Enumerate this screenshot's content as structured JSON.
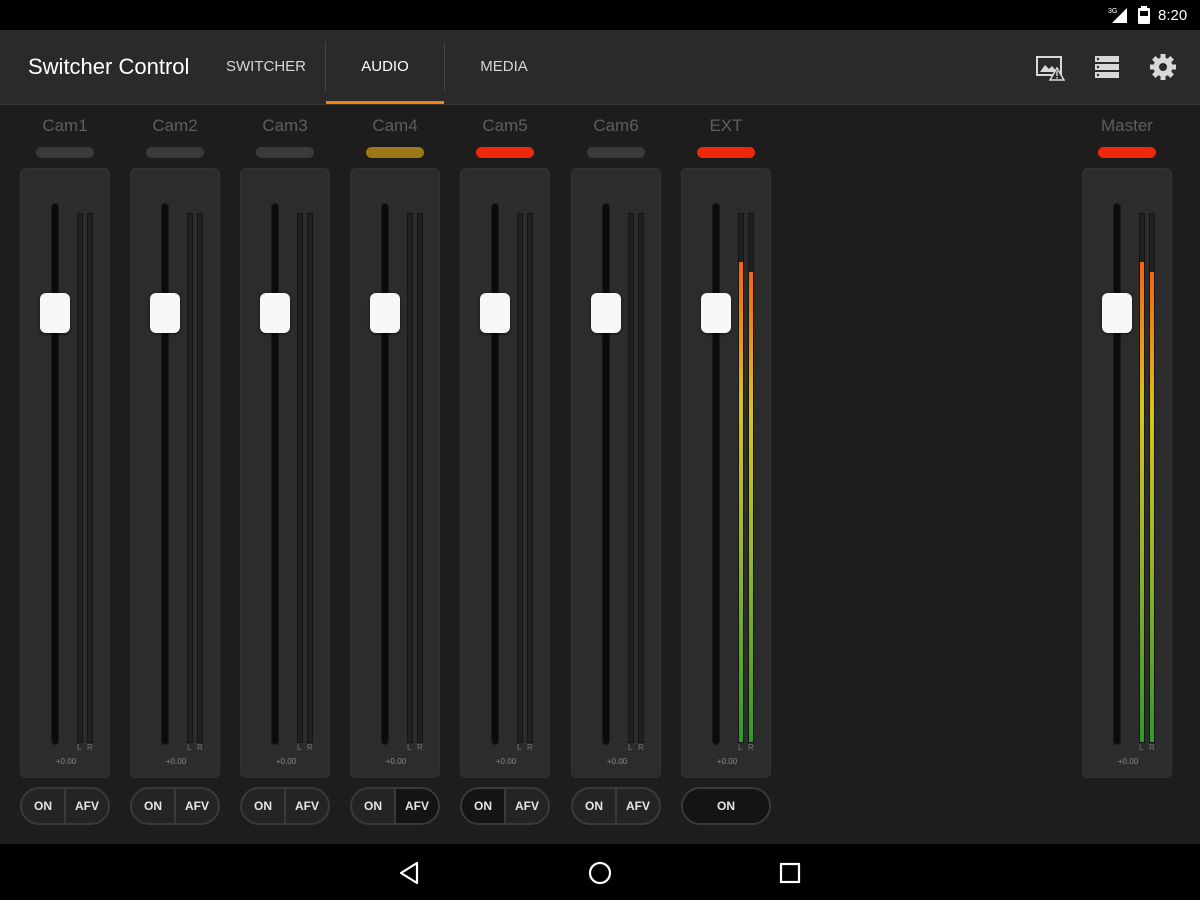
{
  "status_bar": {
    "network_label": "3G",
    "time": "8:20",
    "icons": [
      "signal-icon",
      "battery-icon"
    ]
  },
  "header": {
    "title": "Switcher Control",
    "tabs": [
      {
        "label": "SWITCHER",
        "active": false
      },
      {
        "label": "AUDIO",
        "active": true
      },
      {
        "label": "MEDIA",
        "active": false
      }
    ],
    "actions": [
      "multiview-icon",
      "list-icon",
      "gear-icon"
    ]
  },
  "colors": {
    "accent": "#f0820f",
    "tally_red": "#f0280a",
    "tally_amber": "#9b7818",
    "tally_off": "#3a3a3a"
  },
  "channels": [
    {
      "name": "Cam1",
      "tally": "off",
      "gain": "+0.00",
      "fader_level": 0.82,
      "meter_l": 0,
      "meter_r": 0,
      "buttons": [
        {
          "label": "ON",
          "selected": false
        },
        {
          "label": "AFV",
          "selected": false
        }
      ]
    },
    {
      "name": "Cam2",
      "tally": "off",
      "gain": "+0.00",
      "fader_level": 0.82,
      "meter_l": 0,
      "meter_r": 0,
      "buttons": [
        {
          "label": "ON",
          "selected": false
        },
        {
          "label": "AFV",
          "selected": false
        }
      ]
    },
    {
      "name": "Cam3",
      "tally": "off",
      "gain": "+0.00",
      "fader_level": 0.82,
      "meter_l": 0,
      "meter_r": 0,
      "buttons": [
        {
          "label": "ON",
          "selected": false
        },
        {
          "label": "AFV",
          "selected": false
        }
      ]
    },
    {
      "name": "Cam4",
      "tally": "amber",
      "gain": "+0.00",
      "fader_level": 0.82,
      "meter_l": 0,
      "meter_r": 0,
      "buttons": [
        {
          "label": "ON",
          "selected": false
        },
        {
          "label": "AFV",
          "selected": true
        }
      ]
    },
    {
      "name": "Cam5",
      "tally": "red",
      "gain": "+0.00",
      "fader_level": 0.82,
      "meter_l": 0,
      "meter_r": 0,
      "buttons": [
        {
          "label": "ON",
          "selected": true
        },
        {
          "label": "AFV",
          "selected": false
        }
      ]
    },
    {
      "name": "Cam6",
      "tally": "off",
      "gain": "+0.00",
      "fader_level": 0.82,
      "meter_l": 0,
      "meter_r": 0,
      "buttons": [
        {
          "label": "ON",
          "selected": false
        },
        {
          "label": "AFV",
          "selected": false
        }
      ]
    },
    {
      "name": "EXT",
      "tally": "red",
      "gain": "+0.00",
      "fader_level": 0.82,
      "meter_l": 0.91,
      "meter_r": 0.89,
      "buttons": [
        {
          "label": "ON",
          "selected": true
        }
      ]
    }
  ],
  "master": {
    "name": "Master",
    "tally": "red",
    "gain": "+0.00",
    "fader_level": 0.82,
    "meter_l": 0.91,
    "meter_r": 0.89
  },
  "meter_channel_labels": {
    "left": "L",
    "right": "R"
  },
  "nav_bar": [
    "back-icon",
    "home-icon",
    "recents-icon"
  ]
}
